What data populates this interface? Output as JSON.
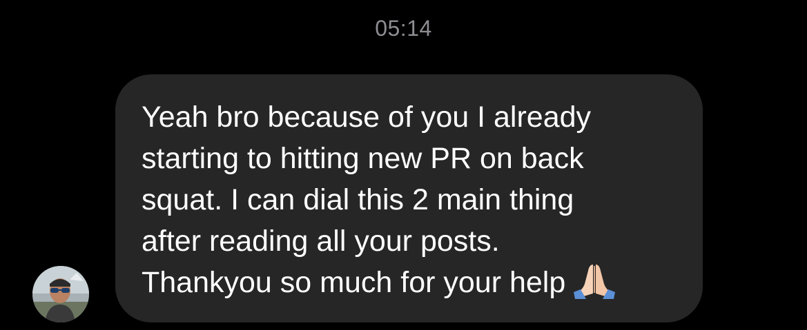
{
  "conversation": {
    "timestamp": "05:14",
    "message": {
      "text": "Yeah bro because of you I already\nstarting to hitting new PR on back\nsquat. I can dial this 2 main thing\nafter reading all your posts.\nThankyou so much for your help",
      "emoji": "folded-hands",
      "bubble_color": "#262626",
      "text_color": "#ffffff"
    },
    "sender": {
      "avatar": "profile-photo"
    }
  }
}
